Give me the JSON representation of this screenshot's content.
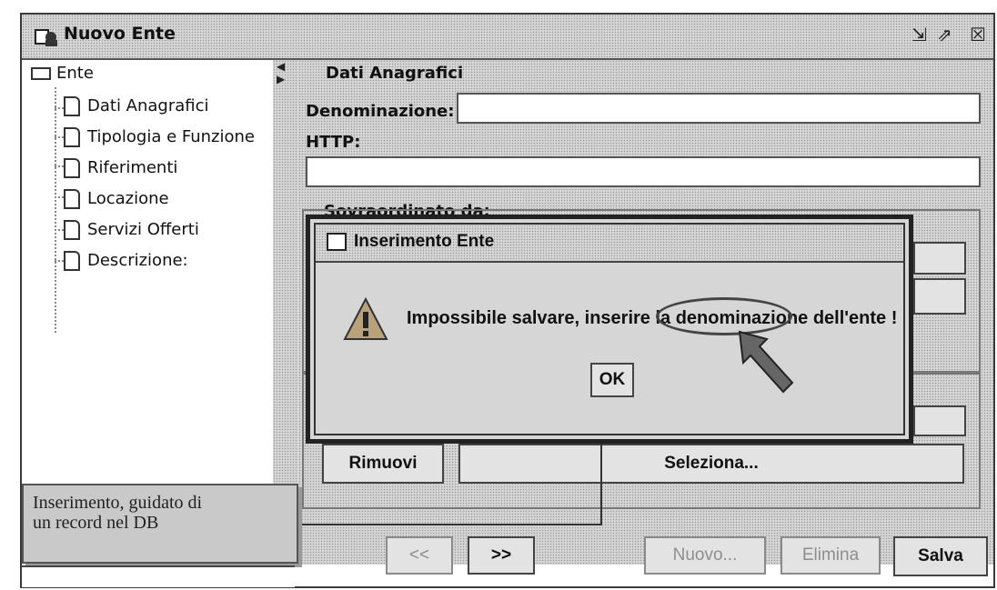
{
  "window": {
    "title": "Nuovo Ente",
    "minimize_glyph": "⇲",
    "maximize_glyph": "⇗",
    "close_glyph": "☒"
  },
  "tree": {
    "root_label": "Ente",
    "items": [
      {
        "label": "Dati Anagrafici"
      },
      {
        "label": "Tipologia e Funzione"
      },
      {
        "label": "Riferimenti"
      },
      {
        "label": "Locazione"
      },
      {
        "label": "Servizi Offerti"
      },
      {
        "label": "Descrizione:"
      }
    ]
  },
  "form": {
    "section_title": "Dati Anagrafici",
    "denominazione_label": "Denominazione:",
    "denominazione_value": "",
    "http_label": "HTTP:",
    "http_value": "",
    "sovraordinato_label": "Sovraordinato da:",
    "remove_button": "Rimuovi",
    "select_button": "Seleziona..."
  },
  "footer": {
    "prev_button": "<<",
    "next_button": ">>",
    "new_button": "Nuovo...",
    "delete_button": "Elimina",
    "save_button": "Salva"
  },
  "dialog": {
    "title": "Inserimento Ente",
    "message": "Impossibile salvare, inserire la denominazione dell'ente !",
    "ok_button": "OK",
    "icon": "warning-icon"
  },
  "caption": {
    "text_line1": "Inserimento, guidato di",
    "text_line2": "un record nel DB"
  }
}
